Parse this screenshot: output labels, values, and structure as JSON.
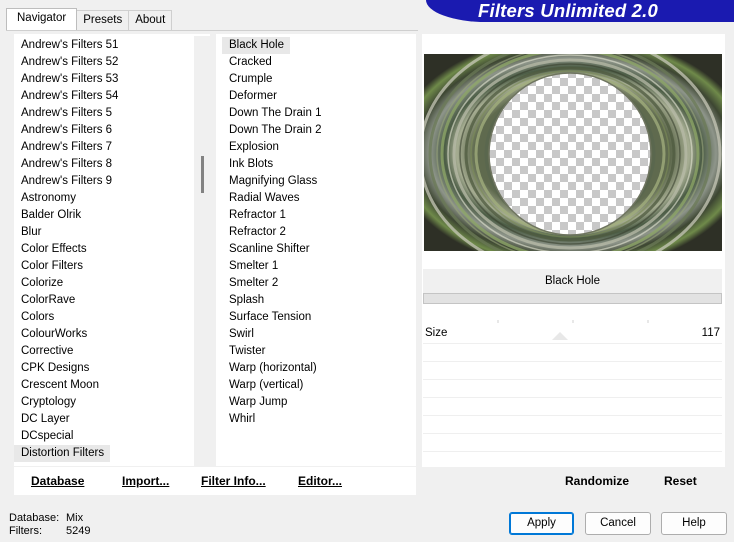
{
  "title": "Filters Unlimited 2.0",
  "tabs": [
    {
      "label": "Navigator",
      "active": true
    },
    {
      "label": "Presets",
      "active": false
    },
    {
      "label": "About",
      "active": false
    }
  ],
  "categories": [
    "Andrew's Filters 51",
    "Andrew's Filters 52",
    "Andrew's Filters 53",
    "Andrew's Filters 54",
    "Andrew's Filters 5",
    "Andrew's Filters 6",
    "Andrew's Filters 7",
    "Andrew's Filters 8",
    "Andrew's Filters 9",
    "Astronomy",
    "Balder Olrik",
    "Blur",
    "Color Effects",
    "Color Filters",
    "Colorize",
    "ColorRave",
    "Colors",
    "ColourWorks",
    "Corrective",
    "CPK Designs",
    "Crescent Moon",
    "Cryptology",
    "DC Layer",
    "DCspecial",
    "Distortion Filters"
  ],
  "selected_category": "Distortion Filters",
  "filters": [
    "Black Hole",
    "Cracked",
    "Crumple",
    "Deformer",
    "Down The Drain 1",
    "Down The Drain 2",
    "Explosion",
    "Ink Blots",
    "Magnifying Glass",
    "Radial Waves",
    "Refractor 1",
    "Refractor 2",
    "Scanline Shifter",
    "Smelter 1",
    "Smelter 2",
    "Splash",
    "Surface Tension",
    "Swirl",
    "Twister",
    "Warp (horizontal)",
    "Warp (vertical)",
    "Warp Jump",
    "Whirl"
  ],
  "selected_filter": "Black Hole",
  "buttons_left": {
    "database": "Database",
    "import": "Import...",
    "filter_info": "Filter Info...",
    "editor": "Editor..."
  },
  "preview": {
    "filter_name": "Black Hole",
    "progress": 0.0
  },
  "control": {
    "label": "Size",
    "value": "117"
  },
  "buttons_right": {
    "randomize": "Randomize",
    "reset": "Reset"
  },
  "status": {
    "database_label": "Database:",
    "database_value": "Mix",
    "filters_label": "Filters:",
    "filters_value": "5249"
  },
  "dialog": {
    "apply": "Apply",
    "cancel": "Cancel",
    "help": "Help"
  },
  "colors": {
    "banner": "#1a1ab0",
    "default_button_border": "#0078d7"
  }
}
